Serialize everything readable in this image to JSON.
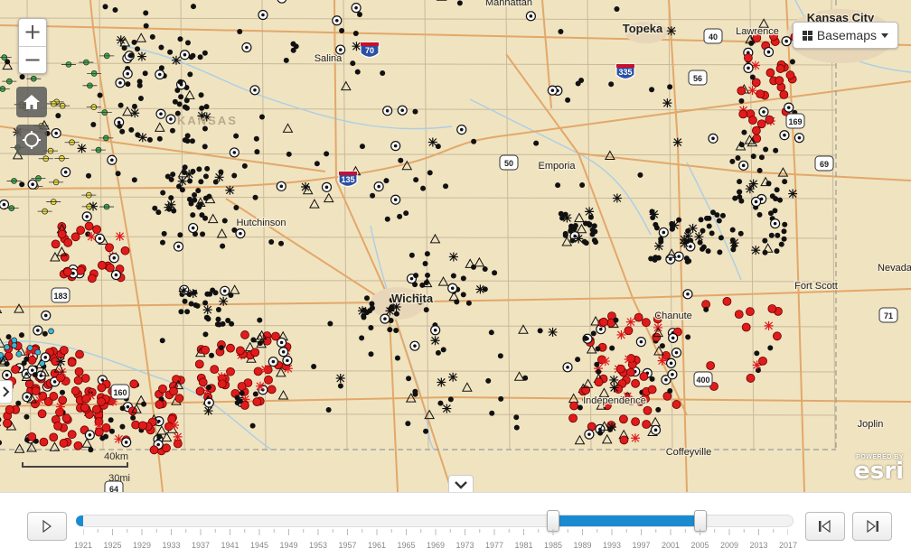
{
  "map": {
    "cities": [
      {
        "name": "Manhattan"
      },
      {
        "name": "Topeka"
      },
      {
        "name": "Lawrence"
      },
      {
        "name": "Kansas City"
      },
      {
        "name": "Salina"
      },
      {
        "name": "Emporia"
      },
      {
        "name": "Hutchinson"
      },
      {
        "name": "Wichita"
      },
      {
        "name": "Fort Scott"
      },
      {
        "name": "Nevada"
      },
      {
        "name": "Chanute"
      },
      {
        "name": "Independence"
      },
      {
        "name": "Coffeyville"
      },
      {
        "name": "Joplin"
      }
    ],
    "state_label": "KANSAS",
    "highway_shields": [
      "70",
      "135",
      "335",
      "40",
      "56",
      "169",
      "69",
      "71",
      "400",
      "160",
      "183",
      "50",
      "64"
    ],
    "colors": {
      "background": "#f0e3c0",
      "roads": "#e2a86a",
      "county_lines": "#c9b99a",
      "water": "#a9cfe6",
      "well_black": "#111111",
      "well_red": "#e01b1b",
      "well_green": "#3cb04a",
      "well_yellow": "#f0e040",
      "well_cyan": "#3ab5d6"
    }
  },
  "controls": {
    "zoom_in": "+",
    "zoom_out": "−",
    "home_icon": "home-icon",
    "locate_icon": "locate-icon",
    "basemaps_label": "Basemaps"
  },
  "scalebar": {
    "km_label": "40km",
    "mi_label": "30mi"
  },
  "attribution": {
    "powered_by": "POWERED BY",
    "name": "esri"
  },
  "timeline": {
    "years": [
      "1921",
      "1925",
      "1929",
      "1933",
      "1937",
      "1941",
      "1945",
      "1949",
      "1953",
      "1957",
      "1961",
      "1965",
      "1969",
      "1973",
      "1977",
      "1981",
      "1985",
      "1989",
      "1993",
      "1997",
      "2001",
      "2005",
      "2009",
      "2013",
      "2017"
    ],
    "range_start_year": 1985,
    "range_end_year": 2005,
    "first_year": 1921,
    "last_year": 2017
  }
}
